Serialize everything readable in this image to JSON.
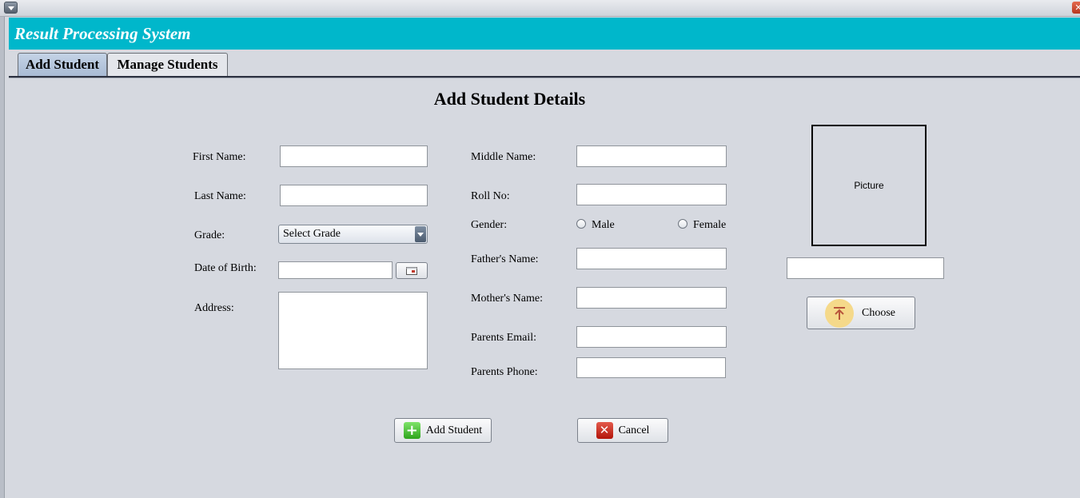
{
  "window": {
    "title": "Result Processing System"
  },
  "tabs": [
    {
      "label": "Add Student"
    },
    {
      "label": "Manage Students"
    }
  ],
  "form": {
    "heading": "Add Student Details",
    "left": {
      "first_name_label": "First Name:",
      "last_name_label": "Last Name:",
      "grade_label": "Grade:",
      "grade_selected": "Select Grade",
      "dob_label": "Date of Birth:",
      "address_label": "Address:"
    },
    "right": {
      "middle_name_label": "Middle Name:",
      "roll_no_label": "Roll No:",
      "gender_label": "Gender:",
      "gender_options": [
        "Male",
        "Female"
      ],
      "father_name_label": "Father's Name:",
      "mother_name_label": "Mother's Name:",
      "parents_email_label": "Parents Email:",
      "parents_phone_label": "Parents Phone:"
    },
    "picture": {
      "placeholder": "Picture",
      "choose_label": "Choose"
    },
    "buttons": {
      "add_label": "Add Student",
      "cancel_label": "Cancel"
    }
  },
  "colors": {
    "header": "#00b7cb",
    "background": "#d6d9e0"
  }
}
